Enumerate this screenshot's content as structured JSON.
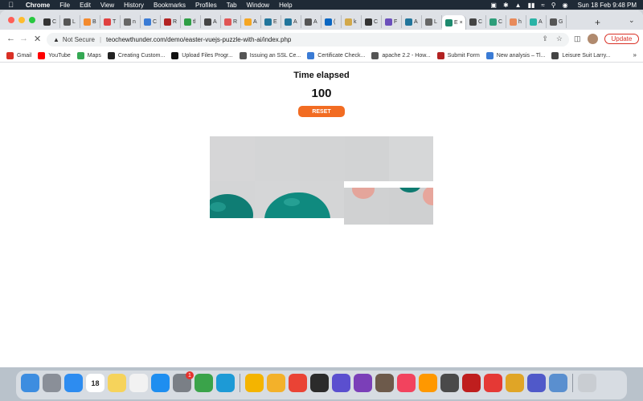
{
  "menubar": {
    "app": "Chrome",
    "menus": [
      "File",
      "Edit",
      "View",
      "History",
      "Bookmarks",
      "Profiles",
      "Tab",
      "Window",
      "Help"
    ],
    "clock": "Sun 18 Feb  9:48 PM"
  },
  "tabs": [
    {
      "label": "C",
      "color": "#333333"
    },
    {
      "label": "L",
      "color": "#555555"
    },
    {
      "label": "B",
      "color": "#f38a2e"
    },
    {
      "label": "T",
      "color": "#e04040"
    },
    {
      "label": "n",
      "color": "#666666"
    },
    {
      "label": "C",
      "color": "#3a7bd5"
    },
    {
      "label": "R",
      "color": "#b22222"
    },
    {
      "label": "tl",
      "color": "#2e9e44"
    },
    {
      "label": "A",
      "color": "#444444"
    },
    {
      "label": "R",
      "color": "#e05555"
    },
    {
      "label": "A",
      "color": "#f5a623"
    },
    {
      "label": "E",
      "color": "#21759b"
    },
    {
      "label": "A",
      "color": "#21759b"
    },
    {
      "label": "A",
      "color": "#555555"
    },
    {
      "label": "(",
      "color": "#0a66c2"
    },
    {
      "label": "k",
      "color": "#d2a84a"
    },
    {
      "label": "C",
      "color": "#333333"
    },
    {
      "label": "F",
      "color": "#6b4fbb"
    },
    {
      "label": "A",
      "color": "#21759b"
    },
    {
      "label": "L",
      "color": "#666666"
    },
    {
      "label": "E",
      "color": "#1e8a6e",
      "active": true
    },
    {
      "label": "C",
      "color": "#444444"
    },
    {
      "label": "C",
      "color": "#2e9e7a"
    },
    {
      "label": "h",
      "color": "#e88a5a"
    },
    {
      "label": "A",
      "color": "#2ab3a6"
    },
    {
      "label": "G",
      "color": "#555555"
    }
  ],
  "toolbar": {
    "security": "Not Secure",
    "separator": "|",
    "url": "teochewthunder.com/demo/easter-vuejs-puzzle-with-ai/index.php",
    "update_label": "Update"
  },
  "bookmarks": [
    {
      "label": "Gmail",
      "color": "#d93025"
    },
    {
      "label": "YouTube",
      "color": "#ff0000"
    },
    {
      "label": "Maps",
      "color": "#34a853"
    },
    {
      "label": "Creating Custom...",
      "color": "#222222"
    },
    {
      "label": "Upload Files Progr...",
      "color": "#111111"
    },
    {
      "label": "Issuing an SSL Ce...",
      "color": "#555555"
    },
    {
      "label": "Certificate Check...",
      "color": "#3a7bd5"
    },
    {
      "label": "apache 2.2 - How...",
      "color": "#555555"
    },
    {
      "label": "Submit Form",
      "color": "#b22222"
    },
    {
      "label": "New analysis – Tl...",
      "color": "#3a7bd5"
    },
    {
      "label": "Leisure Suit Larry...",
      "color": "#444444"
    }
  ],
  "page": {
    "title": "Time elapsed",
    "timer": "100",
    "reset_label": "RESET"
  },
  "dock": [
    {
      "name": "finder",
      "color": "#3d8de0"
    },
    {
      "name": "launchpad",
      "color": "#8a8f98"
    },
    {
      "name": "safari",
      "color": "#2d8cf0"
    },
    {
      "name": "calendar",
      "color": "#ffffff",
      "label": "18"
    },
    {
      "name": "notes",
      "color": "#f6d35b"
    },
    {
      "name": "reminders",
      "color": "#f2f2f2"
    },
    {
      "name": "app-store",
      "color": "#1e8ef0"
    },
    {
      "name": "system-settings",
      "color": "#7a7f86",
      "badge": "1"
    },
    {
      "name": "green-app",
      "color": "#3aa34a"
    },
    {
      "name": "edge",
      "color": "#1d9ad6"
    },
    {
      "name": "photos",
      "color": "#f4b400"
    },
    {
      "name": "yellow-app",
      "color": "#f3b12a"
    },
    {
      "name": "chrome",
      "color": "#ea4335"
    },
    {
      "name": "terminal",
      "color": "#2b2b2b"
    },
    {
      "name": "purple-app",
      "color": "#5b4fcf"
    },
    {
      "name": "github-desktop",
      "color": "#7b3fb8"
    },
    {
      "name": "gimp",
      "color": "#6d5a4b"
    },
    {
      "name": "music",
      "color": "#f2435e"
    },
    {
      "name": "sublime",
      "color": "#ff9800"
    },
    {
      "name": "calculator",
      "color": "#4a4a4a"
    },
    {
      "name": "filezilla",
      "color": "#bf1e1e"
    },
    {
      "name": "anydesk",
      "color": "#e53935"
    },
    {
      "name": "sequel",
      "color": "#e0a526"
    },
    {
      "name": "teams",
      "color": "#5059c9"
    },
    {
      "name": "preview",
      "color": "#5a8fcf"
    },
    {
      "name": "trash",
      "color": "#c9cdd2"
    }
  ]
}
